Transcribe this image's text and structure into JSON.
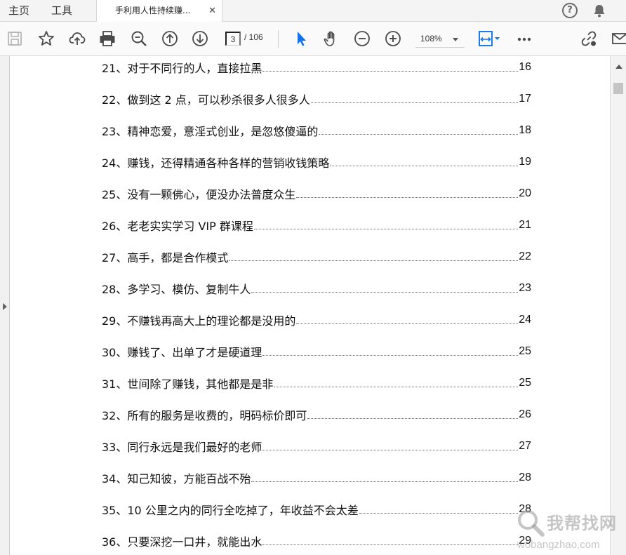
{
  "tabbar": {
    "home_label": "主页",
    "tools_label": "工具",
    "doc_tab_label": "手利用人性持续赚...",
    "close_glyph": "✕",
    "help_glyph": "?"
  },
  "toolbar": {
    "current_page": "3",
    "page_total": "/ 106",
    "zoom": "108%",
    "icons": [
      "save-icon",
      "bookmark-star-icon",
      "upload-cloud-icon",
      "print-icon",
      "zoom-search-icon",
      "previous-page-icon",
      "next-page-icon",
      "select-pointer-icon",
      "hand-icon",
      "zoom-out-icon",
      "zoom-in-icon",
      "fit-page-icon",
      "more-icon",
      "link-share-icon",
      "mail-icon"
    ],
    "accent": "#1473e6"
  },
  "toc": [
    {
      "title": "21、对于不同行的人，直接拉黑",
      "page": "16"
    },
    {
      "title": "22、做到这 2 点，可以秒杀很多人很多人",
      "page": "17"
    },
    {
      "title": "23、精神恋爱，意淫式创业，是忽悠傻逼的",
      "page": "18"
    },
    {
      "title": "24、赚钱，还得精通各种各样的营销收钱策略",
      "page": "19"
    },
    {
      "title": "25、没有一颗佛心，便没办法普度众生",
      "page": "20"
    },
    {
      "title": "26、老老实实学习 VIP 群课程",
      "page": "21"
    },
    {
      "title": "27、高手，都是合作模式",
      "page": "22"
    },
    {
      "title": "28、多学习、模仿、复制牛人",
      "page": "23"
    },
    {
      "title": "29、不赚钱再高大上的理论都是没用的",
      "page": "24"
    },
    {
      "title": "30、赚钱了、出单了才是硬道理",
      "page": "25"
    },
    {
      "title": "31、世间除了赚钱，其他都是是非",
      "page": "25"
    },
    {
      "title": "32、所有的服务是收费的，明码标价即可",
      "page": "26"
    },
    {
      "title": "33、同行永远是我们最好的老师",
      "page": "27"
    },
    {
      "title": "34、知己知彼，方能百战不殆",
      "page": "28"
    },
    {
      "title": "35、10 公里之内的同行全吃掉了，年收益不会太差",
      "page": "28"
    },
    {
      "title": "36、只要深挖一口井，就能出水",
      "page": "29"
    }
  ],
  "watermark": {
    "title": "我帮找网",
    "url": "wobangzhao.com"
  }
}
